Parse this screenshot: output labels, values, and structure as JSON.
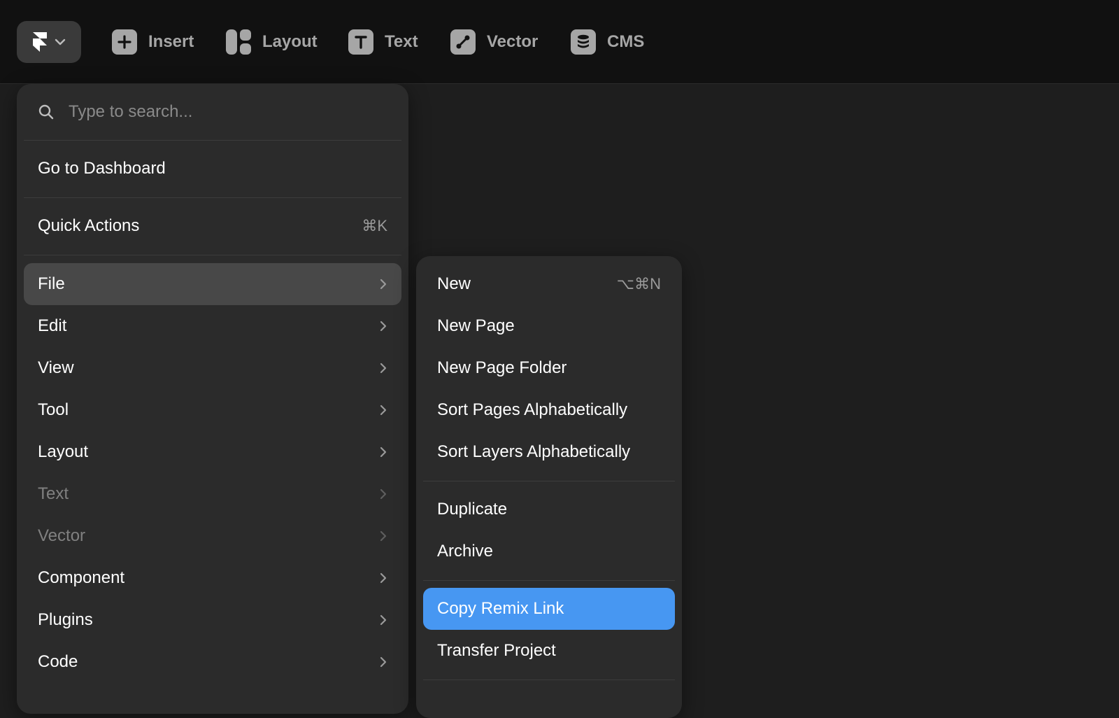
{
  "colors": {
    "toolbar_bg": "#111111",
    "menu_bg": "#2b2b2b",
    "active_item_bg": "#484848",
    "highlight": "#4797f2",
    "muted_text": "#808080"
  },
  "toolbar": {
    "logo_icon": "framer-logo-icon",
    "items": [
      {
        "label": "Insert",
        "icon": "plus-icon"
      },
      {
        "label": "Layout",
        "icon": "layout-icon"
      },
      {
        "label": "Text",
        "icon": "text-icon"
      },
      {
        "label": "Vector",
        "icon": "vector-pen-icon"
      },
      {
        "label": "CMS",
        "icon": "database-icon"
      }
    ]
  },
  "main_menu": {
    "search_placeholder": "Type to search...",
    "dashboard": "Go to Dashboard",
    "quick_actions": {
      "label": "Quick Actions",
      "shortcut": "⌘K"
    },
    "items": [
      {
        "label": "File",
        "state": "active"
      },
      {
        "label": "Edit"
      },
      {
        "label": "View"
      },
      {
        "label": "Tool"
      },
      {
        "label": "Layout"
      },
      {
        "label": "Text",
        "state": "disabled"
      },
      {
        "label": "Vector",
        "state": "disabled"
      },
      {
        "label": "Component"
      },
      {
        "label": "Plugins"
      },
      {
        "label": "Code"
      }
    ]
  },
  "file_submenu": {
    "group1": [
      {
        "label": "New",
        "shortcut": "⌥⌘N"
      },
      {
        "label": "New Page"
      },
      {
        "label": "New Page Folder"
      },
      {
        "label": "Sort Pages Alphabetically"
      },
      {
        "label": "Sort Layers Alphabetically"
      }
    ],
    "group2": [
      {
        "label": "Duplicate"
      },
      {
        "label": "Archive"
      }
    ],
    "group3": [
      {
        "label": "Copy Remix Link",
        "state": "highlighted"
      },
      {
        "label": "Transfer Project"
      }
    ]
  }
}
